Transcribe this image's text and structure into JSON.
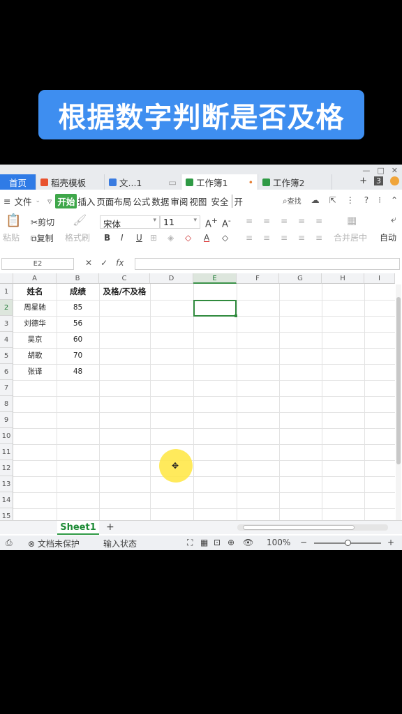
{
  "banner": {
    "text": "根据数字判断是否及格"
  },
  "tabs": {
    "home": "首页",
    "items": [
      {
        "label": "稻壳模板"
      },
      {
        "label": "文...1"
      },
      {
        "label": "工作簿1"
      },
      {
        "label": "工作簿2"
      }
    ],
    "add": "+",
    "count": "3"
  },
  "menu": {
    "file": "文件",
    "items": [
      "开始",
      "插入",
      "页面布局",
      "公式",
      "数据",
      "审阅",
      "视图",
      "安全",
      "开"
    ],
    "search": "查找"
  },
  "ribbon": {
    "paste": "粘贴",
    "cut": "剪切",
    "copy": "复制",
    "format_painter": "格式刷",
    "font_name": "宋体",
    "font_size": "11",
    "merge": "合并居中",
    "autowrap": "自动"
  },
  "formula": {
    "cell_ref": "E2",
    "value": ""
  },
  "columns": [
    "A",
    "B",
    "C",
    "D",
    "E",
    "F",
    "G",
    "H",
    "I"
  ],
  "rows": [
    "1",
    "2",
    "3",
    "4",
    "5",
    "6",
    "7",
    "8",
    "9",
    "10",
    "11",
    "12",
    "13",
    "14",
    "15"
  ],
  "table": {
    "headers": [
      "姓名",
      "成绩",
      "及格/不及格"
    ],
    "rows": [
      {
        "name": "周星驰",
        "score": "85"
      },
      {
        "name": "刘德华",
        "score": "56"
      },
      {
        "name": "吴京",
        "score": "60"
      },
      {
        "name": "胡歌",
        "score": "70"
      },
      {
        "name": "张译",
        "score": "48"
      }
    ]
  },
  "sheet": {
    "tab": "Sheet1",
    "add": "+"
  },
  "status": {
    "protect": "文档未保护",
    "input_state": "输入状态",
    "zoom": "100%"
  },
  "colors": {
    "accent": "#3e8ef0",
    "sheet_green": "#1e8b36"
  }
}
